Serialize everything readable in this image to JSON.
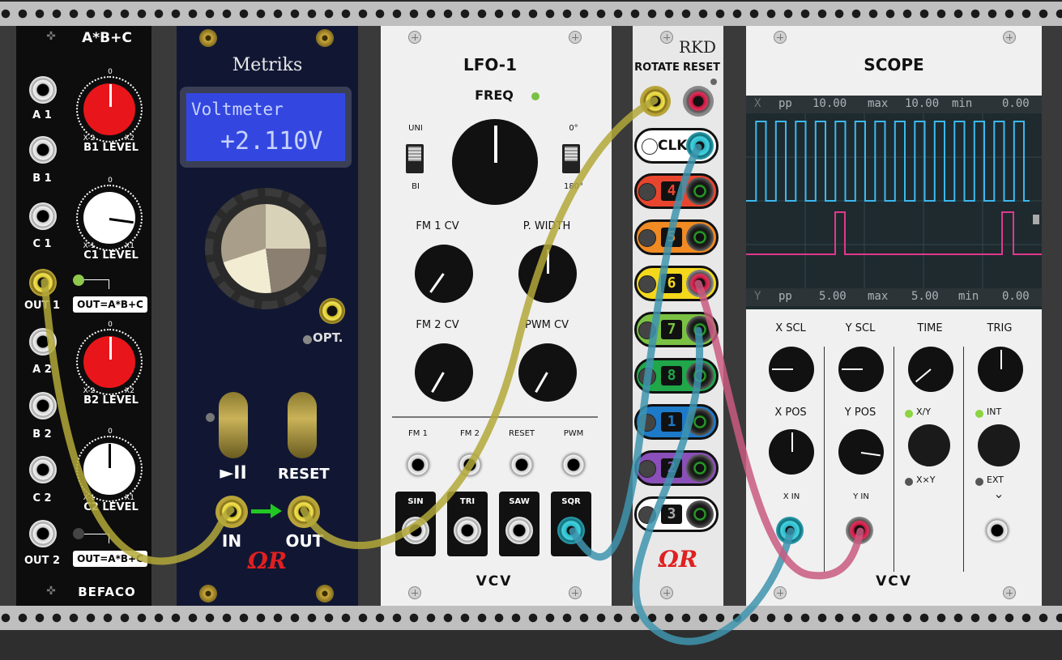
{
  "rack": {
    "title": ""
  },
  "abc": {
    "title": "A*B+C",
    "jack_labels": [
      "A 1",
      "B 1",
      "C 1",
      "OUT 1",
      "A 2",
      "B 2",
      "C 2",
      "OUT 2"
    ],
    "knob_labels": [
      "B1 LEVEL",
      "C1 LEVEL",
      "B2 LEVEL",
      "C2 LEVEL"
    ],
    "knob_scales": {
      "b_left": "X-2",
      "b_right": "X2",
      "c_left": "X-1",
      "c_right": "X1",
      "top": "0"
    },
    "out_labels": [
      "OUT=A*B+C",
      "OUT=A*B+C"
    ],
    "brand": "BEFACO",
    "knob_colors": [
      "#e8161b",
      "#ffffff",
      "#e8161b",
      "#ffffff"
    ]
  },
  "metriks": {
    "title": "Metriks",
    "display_line1": "Voltmeter",
    "display_line2": "+2.110V",
    "opt_label": "OPT.",
    "play_label": "►II",
    "reset_label": "RESET",
    "in_label": "IN",
    "out_label": "OUT",
    "logo": "ΩR",
    "display_color": "#3347e0"
  },
  "lfo": {
    "title": "LFO-1",
    "freq_label": "FREQ",
    "uni_label": "UNI",
    "bi_label": "BI",
    "deg0_label": "0°",
    "deg180_label": "180°",
    "fm1cv_label": "FM 1 CV",
    "pwidth_label": "P. WIDTH",
    "fm2cv_label": "FM 2 CV",
    "pwmcv_label": "PWM CV",
    "input_labels": [
      "FM 1",
      "FM 2",
      "RESET",
      "PWM"
    ],
    "output_labels": [
      "SIN",
      "TRI",
      "SAW",
      "SQR"
    ],
    "brand": "VCV"
  },
  "rkd": {
    "title": "RKD",
    "rotate_label": "ROTATE",
    "reset_label": "RESET",
    "clk_label": "CLK",
    "rows": [
      {
        "num": "4",
        "color": "#e8452f"
      },
      {
        "num": "5",
        "color": "#f08a22"
      },
      {
        "num": "6",
        "color": "#f4d81c"
      },
      {
        "num": "7",
        "color": "#7ac143"
      },
      {
        "num": "8",
        "color": "#1fa74a"
      },
      {
        "num": "1",
        "color": "#1d7ac9"
      },
      {
        "num": "2",
        "color": "#8a4fb8"
      },
      {
        "num": "3",
        "color": "#ffffff"
      }
    ],
    "logo": "ΩR"
  },
  "scope": {
    "title": "SCOPE",
    "x_readout": {
      "axis": "X",
      "pp_label": "pp",
      "pp": "10.00",
      "max_label": "max",
      "max": "10.00",
      "min_label": "min",
      "min": "0.00"
    },
    "y_readout": {
      "axis": "Y",
      "pp_label": "pp",
      "pp": "5.00",
      "max_label": "max",
      "max": "5.00",
      "min_label": "min",
      "min": "0.00"
    },
    "knob_labels": [
      "X SCL",
      "Y SCL",
      "TIME",
      "TRIG"
    ],
    "pos_labels": [
      "X POS",
      "Y POS"
    ],
    "xy_label": "X/Y",
    "xxy_label": "X×Y",
    "int_label": "INT",
    "ext_label": "EXT",
    "xin_label": "X IN",
    "yin_label": "Y IN",
    "chevron": "⌄",
    "brand": "VCV",
    "trace_colors": {
      "x": "#3cb9f0",
      "y": "#e0388e"
    }
  },
  "cables": {
    "colors": [
      "#b3a83a",
      "#3e94ae",
      "#c95a80"
    ]
  }
}
